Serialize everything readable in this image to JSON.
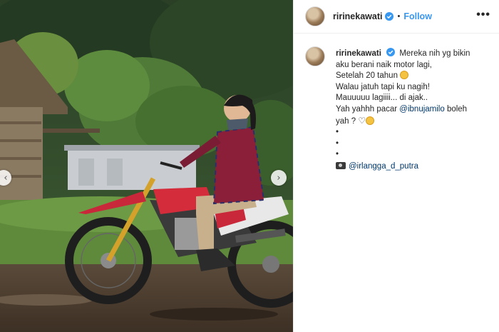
{
  "post": {
    "username": "ririnekawati",
    "follow_label": "Follow",
    "separator": "•",
    "more_label": "•••"
  },
  "caption": {
    "username": "ririnekawati",
    "line1": "Mereka nih yg bikin",
    "line2": "aku berani naik motor lagi,",
    "line3": "Setelah 20 tahun",
    "line4": "Walau jatuh tapi ku nagih!",
    "line5": "Mauuuuu lagiiii... di ajak..",
    "line6_prefix": "Yah yahhh pacar ",
    "line6_mention": "@ibnujamilo",
    "line6_suffix": " boleh",
    "line7": "yah ?",
    "bullet": "•",
    "credit_mention": "@irlangga_d_putra"
  },
  "icons": {
    "verified": "verified-badge-icon",
    "heart": "heart-outline-icon",
    "smile": "grinning-face-icon",
    "camera": "camera-icon",
    "prev": "chevron-left-icon",
    "next": "chevron-right-icon"
  },
  "colors": {
    "link_blue": "#3897f0",
    "mention": "#00376b",
    "text": "#262626"
  }
}
